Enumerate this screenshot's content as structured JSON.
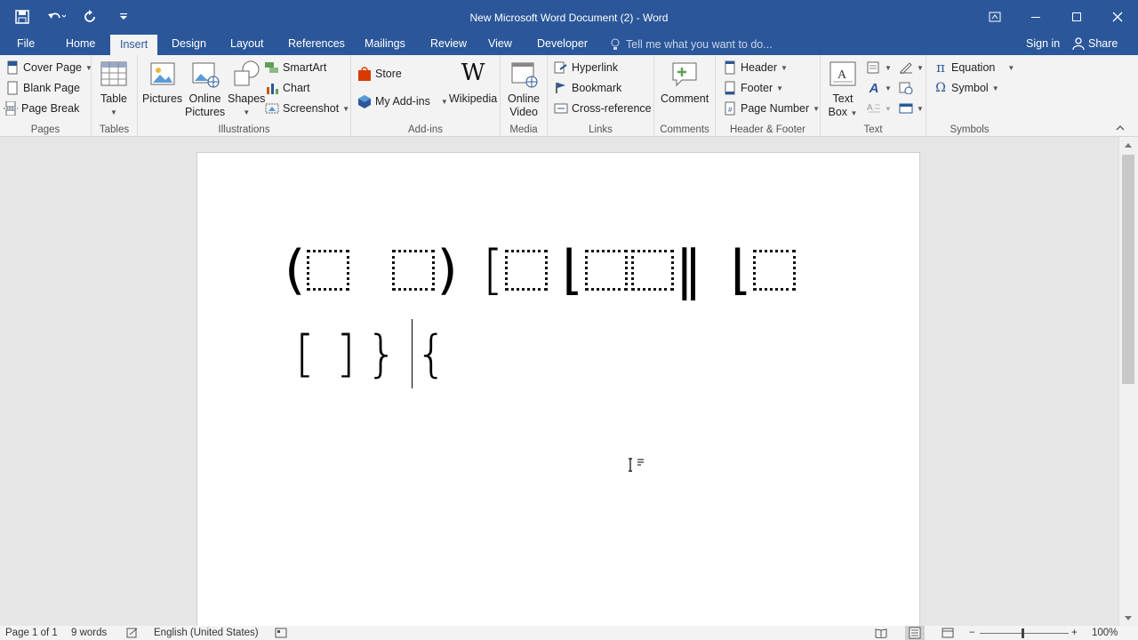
{
  "window": {
    "title": "New Microsoft Word Document (2) - Word",
    "minimize_icon": "minimize-icon",
    "maximize_icon": "maximize-icon",
    "close_icon": "close-icon",
    "ribbon_display_icon": "ribbon-display-options-icon"
  },
  "qat": {
    "save": "save-icon",
    "undo": "undo-icon",
    "redo": "repeat-icon",
    "customize": "customize-qat-icon"
  },
  "tabs": [
    "File",
    "Home",
    "Insert",
    "Design",
    "Layout",
    "References",
    "Mailings",
    "Review",
    "View",
    "Developer"
  ],
  "active_tab": "Insert",
  "tellme": {
    "placeholder": "Tell me what you want to do..."
  },
  "account": {
    "signin": "Sign in",
    "share": "Share"
  },
  "ribbon": {
    "pages": {
      "label": "Pages",
      "cover_page": "Cover Page",
      "blank_page": "Blank Page",
      "page_break": "Page Break"
    },
    "tables": {
      "label": "Tables",
      "table": "Table"
    },
    "illustrations": {
      "label": "Illustrations",
      "pictures": "Pictures",
      "online_pictures_1": "Online",
      "online_pictures_2": "Pictures",
      "shapes": "Shapes",
      "smartart": "SmartArt",
      "chart": "Chart",
      "screenshot": "Screenshot"
    },
    "addins": {
      "label": "Add-ins",
      "store": "Store",
      "my_addins": "My Add-ins",
      "wikipedia": "Wikipedia"
    },
    "media": {
      "label": "Media",
      "online_video_1": "Online",
      "online_video_2": "Video"
    },
    "links": {
      "label": "Links",
      "hyperlink": "Hyperlink",
      "bookmark": "Bookmark",
      "cross_reference": "Cross-reference"
    },
    "comments": {
      "label": "Comments",
      "comment": "Comment"
    },
    "header_footer": {
      "label": "Header & Footer",
      "header": "Header",
      "footer": "Footer",
      "page_number": "Page Number"
    },
    "text": {
      "label": "Text",
      "text_box_1": "Text",
      "text_box_2": "Box"
    },
    "symbols": {
      "label": "Symbols",
      "equation": "Equation",
      "symbol": "Symbol"
    }
  },
  "document": {
    "line1_open_paren": "(",
    "line1_close_paren": ")",
    "line1_open_bracket": "[",
    "line1_floor_1": "⌊",
    "line1_double_bar": "‖",
    "line1_floor_2": "⌊",
    "line2": [
      "[",
      "]",
      "}",
      "{"
    ]
  },
  "status": {
    "page": "Page 1 of 1",
    "words": "9 words",
    "language": "English (United States)",
    "zoom": "100%",
    "proofing_icon": "proofing-icon",
    "macro_icon": "macro-recording-icon",
    "read_mode_icon": "read-mode-icon",
    "print_layout_icon": "print-layout-icon",
    "web_layout_icon": "web-layout-icon"
  }
}
